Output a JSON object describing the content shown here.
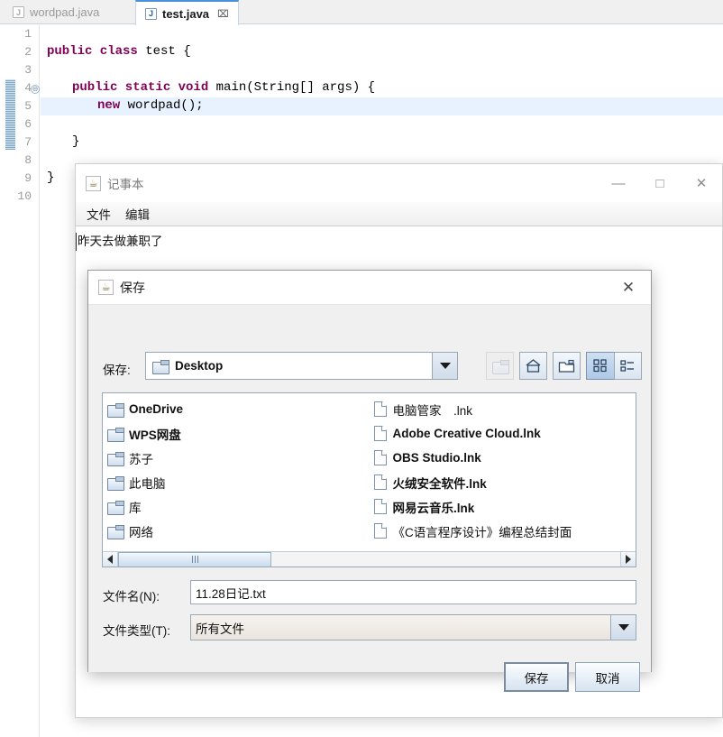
{
  "ide": {
    "tabs": [
      {
        "label": "wordpad.java",
        "icon": "java-file-icon",
        "active": false
      },
      {
        "label": "test.java",
        "icon": "java-file-icon",
        "active": true,
        "close": "⌧"
      }
    ],
    "line_numbers": [
      "1",
      "2",
      "3",
      "4",
      "5",
      "6",
      "7",
      "8",
      "9",
      "10"
    ],
    "code": {
      "l2_kw": "public class",
      "l2_rest": " test {",
      "l4_kw": "public static void",
      "l4_rest": " main(String[] args) {",
      "l5_kw": "new",
      "l5_rest": " wordpad();",
      "l7": "}",
      "l9": "}"
    },
    "fold_marker": "⊖"
  },
  "notepad": {
    "title": "记事本",
    "app_icon": "☕",
    "menu": [
      "文件",
      "编辑"
    ],
    "content": "昨天去做兼职了",
    "controls": {
      "minimize": "—",
      "maximize": "□",
      "close": "✕"
    }
  },
  "save_dialog": {
    "title": "保存",
    "app_icon": "☕",
    "close": "✕",
    "save_in_label": "保存:",
    "current_folder": "Desktop",
    "toolbar": [
      {
        "name": "up-folder-icon",
        "glyph": "⬆",
        "state": "disabled"
      },
      {
        "name": "home-icon",
        "glyph": "⌂",
        "state": "normal"
      },
      {
        "name": "new-folder-icon",
        "glyph": "὜0",
        "state": "normal"
      },
      {
        "name": "grid-view-icon",
        "glyph": "▦",
        "state": "selected"
      },
      {
        "name": "list-view-icon",
        "glyph": "☰",
        "state": "normal"
      }
    ],
    "folders": [
      {
        "label": "OneDrive",
        "bold": true
      },
      {
        "label": "WPS网盘",
        "bold": true
      },
      {
        "label": "苏子",
        "bold": false
      },
      {
        "label": "此电脑",
        "bold": false
      },
      {
        "label": "库",
        "bold": false
      },
      {
        "label": "网络",
        "bold": false
      }
    ],
    "files": [
      {
        "label": "电脑管家　.lnk",
        "bold": false
      },
      {
        "label": "Adobe Creative Cloud.lnk",
        "bold": true
      },
      {
        "label": "OBS Studio.lnk",
        "bold": true
      },
      {
        "label": "火绒安全软件.lnk",
        "bold": true
      },
      {
        "label": "网易云音乐.lnk",
        "bold": true
      },
      {
        "label": "《C语言程序设计》编程总结封面",
        "bold": false
      }
    ],
    "filename_label": "文件名(N):",
    "filename_value": "11.28日记.txt",
    "filetype_label": "文件类型(T):",
    "filetype_value": "所有文件",
    "save_button": "保存",
    "cancel_button": "取消"
  },
  "colors": {
    "keyword": "#7f0055",
    "active_tab_border": "#4a90d9",
    "highlight_line": "#e8f2fe"
  }
}
